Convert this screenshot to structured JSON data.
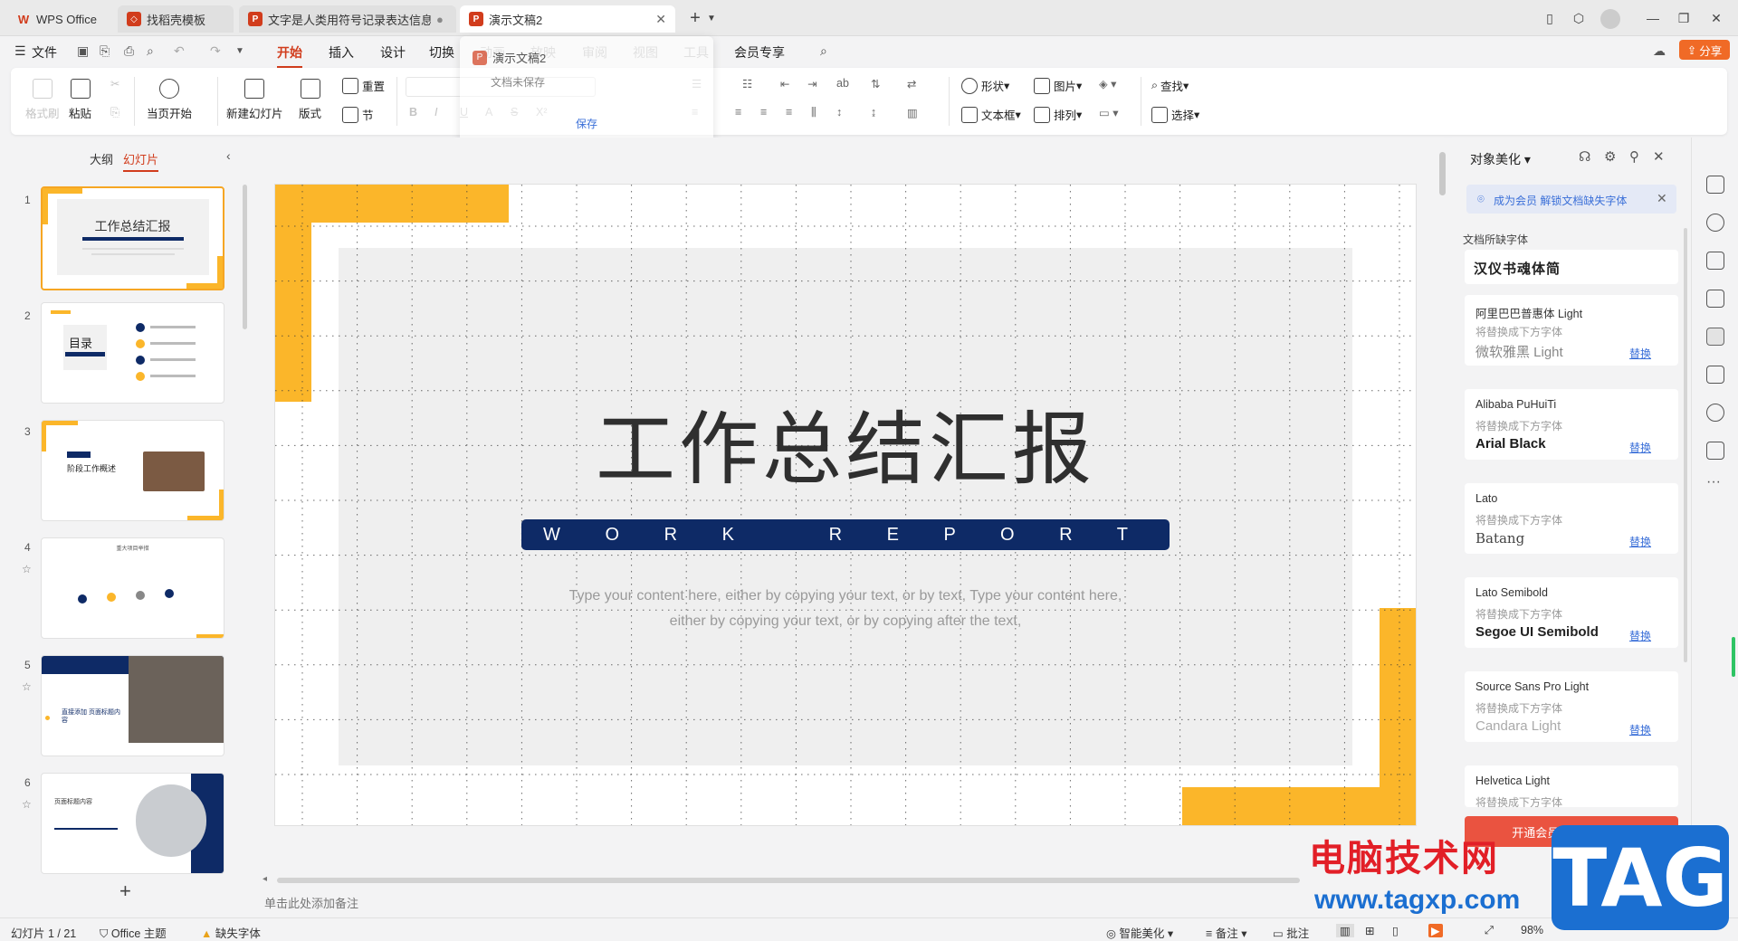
{
  "tabs": [
    {
      "label": "WPS Office",
      "icon": "wps-logo-icon",
      "color": "#d13c1c"
    },
    {
      "label": "找稻壳模板",
      "icon": "docer-icon",
      "color": "#d13c1c"
    },
    {
      "label": "文字是人类用符号记录表达信息以",
      "icon": "ppt-icon",
      "color": "#d13c1c"
    },
    {
      "label": "演示文稿2",
      "icon": "ppt-icon",
      "color": "#d13c1c"
    }
  ],
  "menu": {
    "file": "文件",
    "items": [
      "开始",
      "插入",
      "设计",
      "切换",
      "动画",
      "放映",
      "审阅",
      "视图",
      "工具",
      "会员专享"
    ],
    "share": "分享"
  },
  "popup": {
    "title": "演示文稿2",
    "status": "文档未保存",
    "save": "保存"
  },
  "ribbon": {
    "format_painter": "格式刷",
    "paste": "粘贴",
    "from_current": "当页开始",
    "new_slide": "新建幻灯片",
    "layout": "版式",
    "reset": "重置",
    "section": "节",
    "shape": "形状",
    "picture": "图片",
    "textbox": "文本框",
    "arrange": "排列",
    "find": "查找",
    "select": "选择"
  },
  "left": {
    "tab_outline": "大纲",
    "tab_slides": "幻灯片",
    "slides": [
      {
        "num": "1",
        "title": "工作总结汇报"
      },
      {
        "num": "2",
        "title": "目录"
      },
      {
        "num": "3",
        "title": "阶段工作概述"
      },
      {
        "num": "4",
        "title": "重大项目举措"
      },
      {
        "num": "5",
        "title": "直接添加 页面标题内容"
      },
      {
        "num": "6",
        "title": "页面标题内容"
      }
    ],
    "add": "+"
  },
  "slide": {
    "title": "工作总结汇报",
    "subtitle": "W O R K   R E P O R T",
    "body_line1": "Type your content here, either by copying your text, or by text, Type your content here,",
    "body_line2": "either by copying your text, or by copying after the text,",
    "accent": "#fbb62a",
    "navy": "#0e2a66"
  },
  "notes_placeholder": "单击此处添加备注",
  "right": {
    "title": "对象美化",
    "vip_tip": "成为会员 解锁文档缺失字体",
    "section": "文档所缺字体",
    "first_font": "汉仪书魂体简",
    "replace_hint": "将替换成下方字体",
    "replace_btn": "替换",
    "fonts": [
      {
        "missing": "阿里巴巴普惠体 Light",
        "replacement": "微软雅黑 Light"
      },
      {
        "missing": "Alibaba PuHuiTi",
        "replacement": "Arial Black"
      },
      {
        "missing": "Lato",
        "replacement": "Batang"
      },
      {
        "missing": "Lato Semibold",
        "replacement": "Segoe UI Semibold"
      },
      {
        "missing": "Source Sans Pro Light",
        "replacement": "Candara Light"
      },
      {
        "missing": "Helvetica Light",
        "replacement": ""
      }
    ],
    "download_btn": "开通会员后下载（12）"
  },
  "status": {
    "slide_count": "幻灯片 1 / 21",
    "theme": "Office 主题",
    "missing_font": "缺失字体",
    "smart": "智能美化",
    "notes": "备注",
    "comments": "批注",
    "zoom": "98%"
  },
  "watermark": {
    "site_cn": "电脑技术网",
    "url": "www.tagxp.com",
    "tag": "TAG"
  }
}
